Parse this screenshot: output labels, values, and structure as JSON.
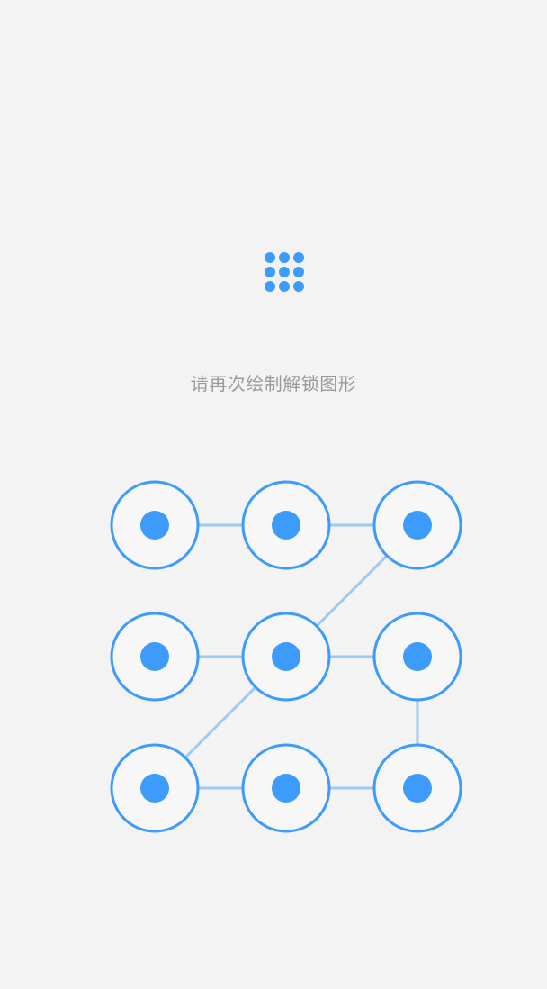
{
  "colors": {
    "background": "#f3f3f3",
    "accent": "#3d9bfb",
    "ring": "#3d9bfb",
    "line": "#9ccaf4",
    "node_fill": "#f7f7f7"
  },
  "header_icon": {
    "name": "pattern-grid-icon",
    "dots": 9
  },
  "prompt": {
    "text": "请再次绘制解锁图形"
  },
  "pattern_lock": {
    "rows": 3,
    "cols": 3,
    "selected_nodes": [
      1,
      2,
      3,
      4,
      5,
      6,
      7,
      8,
      9
    ],
    "connections": [
      [
        1,
        2
      ],
      [
        2,
        3
      ],
      [
        3,
        5
      ],
      [
        4,
        5
      ],
      [
        5,
        6
      ],
      [
        5,
        7
      ],
      [
        6,
        9
      ],
      [
        7,
        8
      ],
      [
        8,
        9
      ]
    ]
  }
}
